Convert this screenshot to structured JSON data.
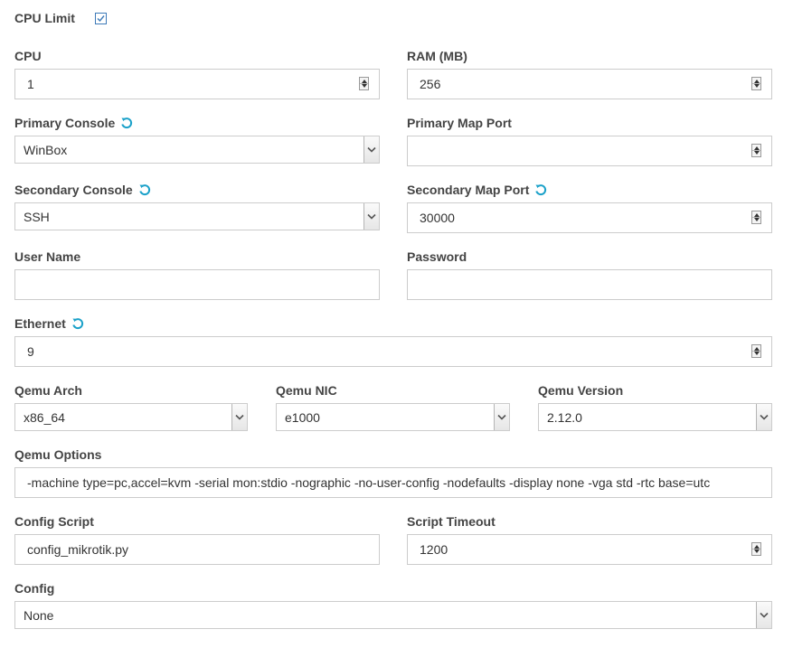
{
  "cpu_limit": {
    "label": "CPU Limit",
    "checked": true
  },
  "cpu": {
    "label": "CPU",
    "value": "1"
  },
  "ram": {
    "label": "RAM (MB)",
    "value": "256"
  },
  "primary_console": {
    "label": "Primary Console",
    "value": "WinBox"
  },
  "primary_map_port": {
    "label": "Primary Map Port",
    "value": ""
  },
  "secondary_console": {
    "label": "Secondary Console",
    "value": "SSH"
  },
  "secondary_map_port": {
    "label": "Secondary Map Port",
    "value": "30000"
  },
  "user_name": {
    "label": "User Name",
    "value": ""
  },
  "password": {
    "label": "Password",
    "value": ""
  },
  "ethernet": {
    "label": "Ethernet",
    "value": "9"
  },
  "qemu_arch": {
    "label": "Qemu Arch",
    "value": "x86_64"
  },
  "qemu_nic": {
    "label": "Qemu NIC",
    "value": "e1000"
  },
  "qemu_version": {
    "label": "Qemu Version",
    "value": "2.12.0"
  },
  "qemu_options": {
    "label": "Qemu Options",
    "value": "-machine type=pc,accel=kvm -serial mon:stdio -nographic -no-user-config -nodefaults -display none -vga std -rtc base=utc"
  },
  "config_script": {
    "label": "Config Script",
    "value": "config_mikrotik.py"
  },
  "script_timeout": {
    "label": "Script Timeout",
    "value": "1200"
  },
  "config": {
    "label": "Config",
    "value": "None"
  },
  "icons": {
    "reset": "reset-icon",
    "spinner": "spinner-arrows-icon",
    "dropdown": "chevron-down-icon",
    "check": "check-icon"
  },
  "colors": {
    "accent": "#1ba1c9",
    "label": "#444444",
    "border": "#cccccc",
    "checkbox": "#3d7ab8"
  }
}
